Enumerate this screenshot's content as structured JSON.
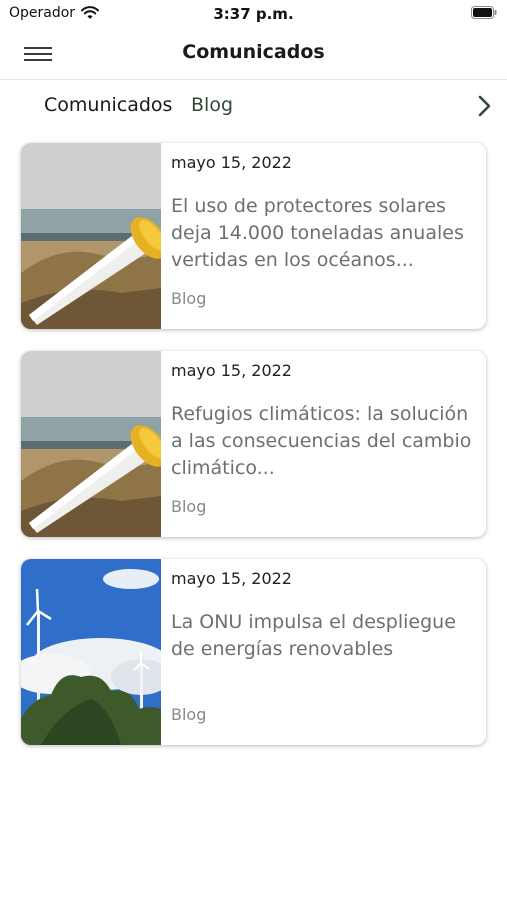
{
  "status_bar": {
    "carrier": "Operador",
    "time": "3:37 p.m."
  },
  "navbar": {
    "title": "Comunicados",
    "menu_icon": "hamburger-menu-icon"
  },
  "tabs": [
    {
      "label": "Comunicados"
    },
    {
      "label": "Blog"
    }
  ],
  "tab_next_icon": "chevron-right-icon",
  "colors": {
    "tab_active": "#2e4a3a",
    "headline": "#6f6f6f",
    "category": "#8a8a8a"
  },
  "articles": [
    {
      "date": "mayo 15, 2022",
      "title": "El uso de protectores solares deja 14.000 toneladas anuales vertidas en los océanos...",
      "category": "Blog",
      "image": "sunscreen-beach-photo"
    },
    {
      "date": "mayo 15, 2022",
      "title": "Refugios climáticos: la solución a las consecuencias del cambio climático...",
      "category": "Blog",
      "image": "sunscreen-beach-photo"
    },
    {
      "date": "mayo 15, 2022",
      "title": "La ONU impulsa el despliegue de energías renovables",
      "category": "Blog",
      "image": "wind-turbines-photo"
    }
  ]
}
